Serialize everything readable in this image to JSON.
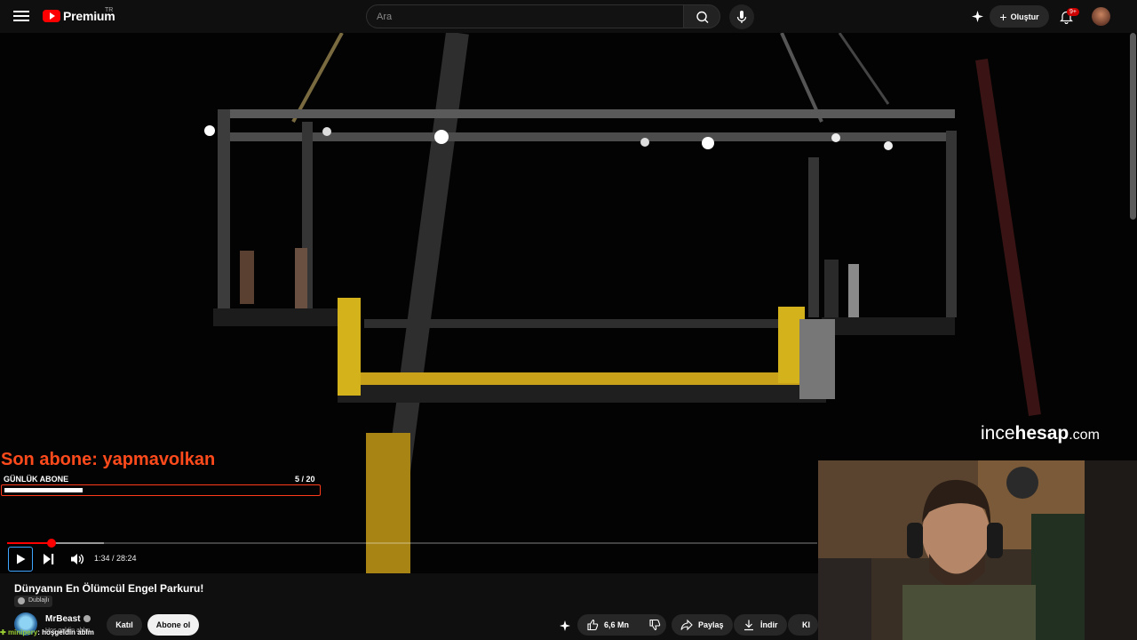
{
  "header": {
    "logo_text": "Premium",
    "country": "TR",
    "search_placeholder": "Ara",
    "create_label": "Oluştur",
    "notifications_badge": "9+"
  },
  "overlay": {
    "last_subscriber": "Son abone: yapmavolkan",
    "daily_label": "GÜNLÜK ABONE",
    "daily_count": "5  / 20",
    "daily_progress": 0.25
  },
  "watermark": {
    "part1": "ince",
    "part2": "hesap",
    "part3": ".com"
  },
  "player": {
    "time": "1:34 / 28:24",
    "played_fraction": 0.055,
    "buffered_fraction": 0.12
  },
  "video": {
    "title": "Dünyanın En Ölümcül Engel Parkuru!",
    "dub_label": "Dublajlı",
    "channel_name": "MrBeast",
    "subscribers": "Hoş geldin ablm",
    "join_label": "Katıl",
    "subscribe_label": "Abone ol",
    "likes": "6,6 Mn",
    "share_label": "Paylaş",
    "download_label": "İndir",
    "clip_label": "Kl"
  },
  "chat": {
    "user": "minipery",
    "message": ": hoşgeldin ablm"
  }
}
